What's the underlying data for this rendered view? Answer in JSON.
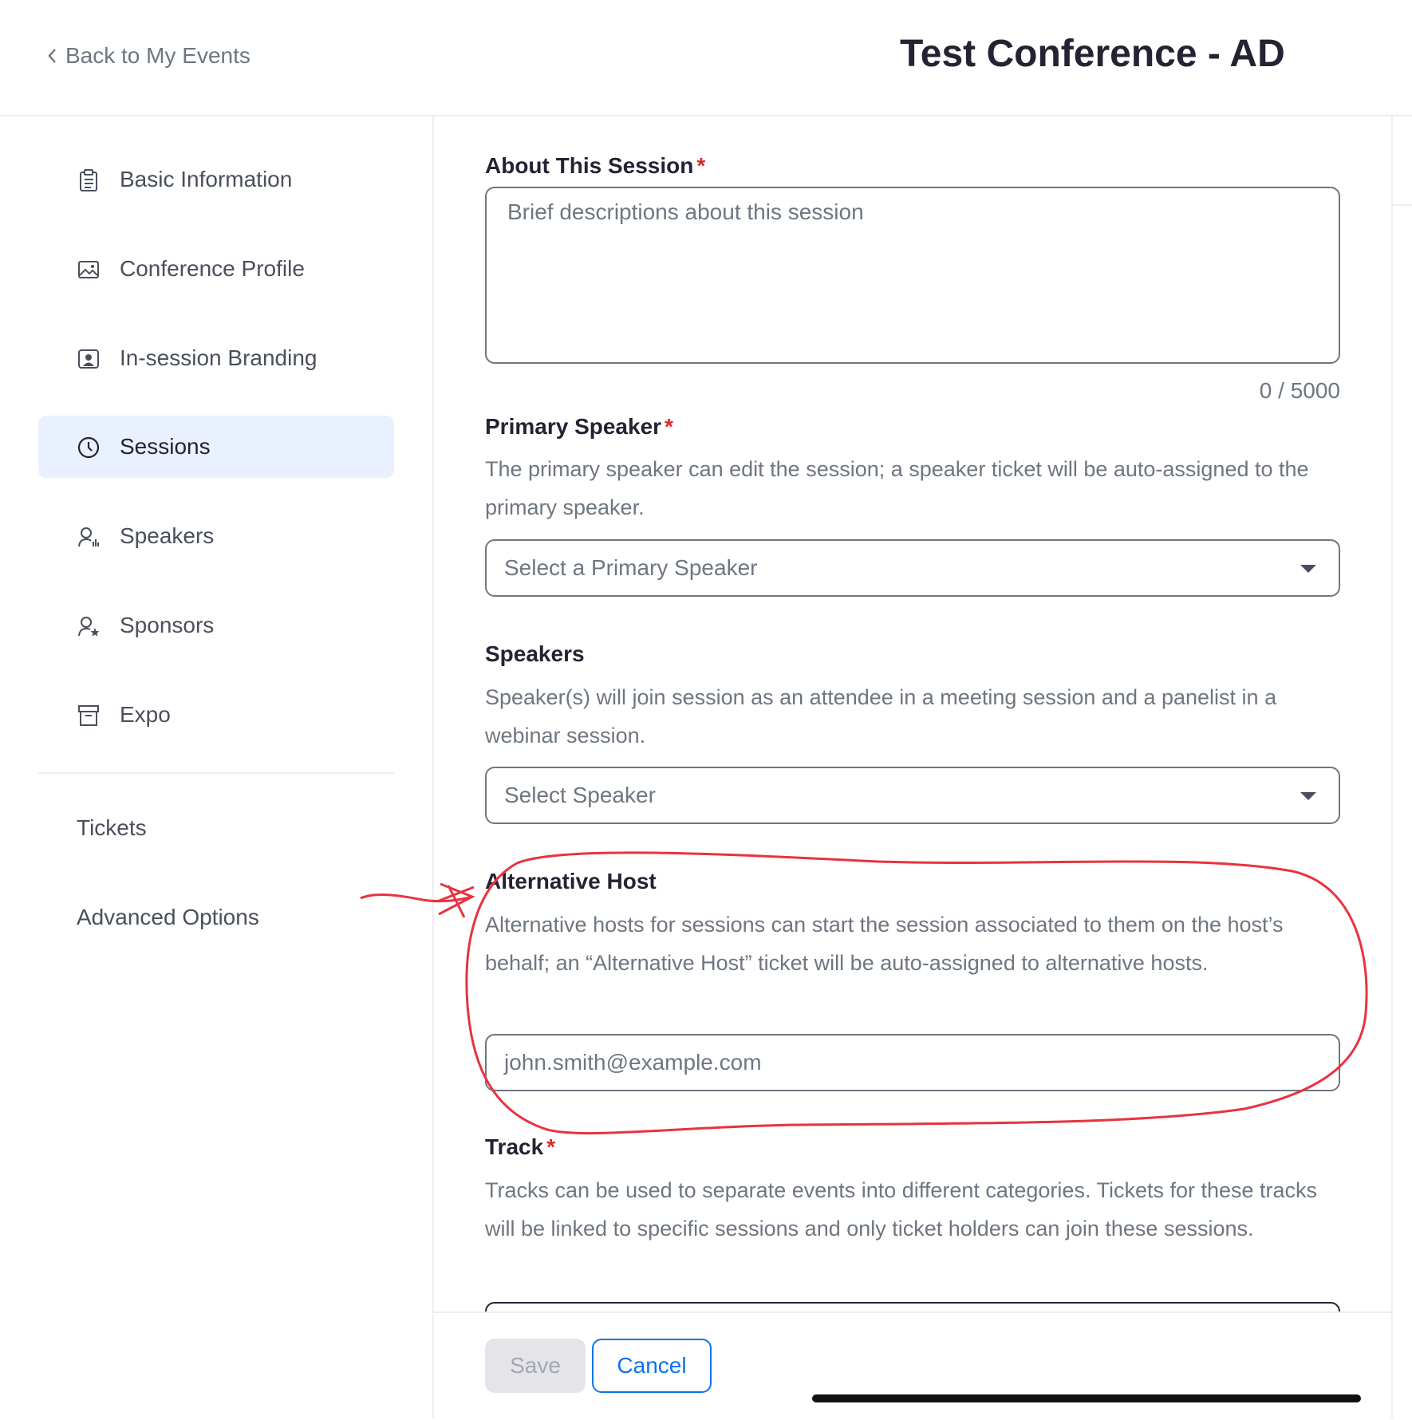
{
  "header": {
    "back_label": "Back to My Events",
    "title": "Test Conference - AD"
  },
  "sidebar": {
    "items": [
      {
        "label": "Basic Information",
        "icon": "clipboard-icon",
        "active": false
      },
      {
        "label": "Conference Profile",
        "icon": "image-icon",
        "active": false
      },
      {
        "label": "In-session Branding",
        "icon": "portrait-icon",
        "active": false
      },
      {
        "label": "Sessions",
        "icon": "clock-icon",
        "active": true
      },
      {
        "label": "Speakers",
        "icon": "speaker-icon",
        "active": false
      },
      {
        "label": "Sponsors",
        "icon": "sponsor-icon",
        "active": false
      },
      {
        "label": "Expo",
        "icon": "booth-icon",
        "active": false
      }
    ],
    "secondary": [
      "Tickets",
      "Advanced Options"
    ]
  },
  "form": {
    "about": {
      "label": "About This Session",
      "required_mark": "*",
      "placeholder": "Brief descriptions about this session",
      "counter": "0 / 5000"
    },
    "primary_speaker": {
      "label": "Primary Speaker",
      "required_mark": "*",
      "description": "The primary speaker can edit the session; a speaker ticket will be auto-assigned to the primary speaker.",
      "placeholder": "Select a Primary Speaker"
    },
    "speakers": {
      "label": "Speakers",
      "description": "Speaker(s) will join session as an attendee in a meeting session and a panelist in a webinar session.",
      "placeholder": "Select Speaker"
    },
    "alternative_host": {
      "label": "Alternative Host",
      "description": "Alternative hosts for sessions can start the session associated to them on the host’s behalf; an “Alternative Host” ticket will be auto-assigned to alternative hosts.",
      "placeholder": "john.smith@example.com"
    },
    "track": {
      "label": "Track",
      "required_mark": "*",
      "description": "Tracks can be used to separate events into different categories. Tickets for these tracks will be linked to specific sessions and only ticket holders can join these sessions."
    }
  },
  "footer": {
    "save_label": "Save",
    "cancel_label": "Cancel"
  },
  "colors": {
    "accent": "#0e72ed",
    "active_nav_bg": "#e8f1fd",
    "required": "#e02828",
    "annotation": "#e8333f"
  }
}
